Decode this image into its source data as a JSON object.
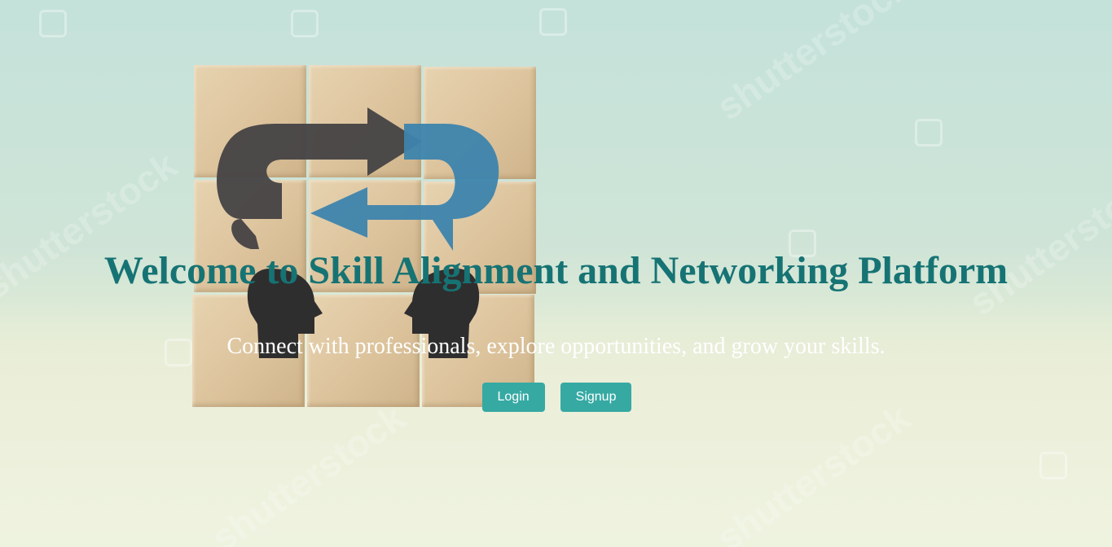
{
  "hero": {
    "title": "Welcome to Skill Alignment and Networking Platform",
    "subtitle": "Connect with professionals, explore opportunities, and grow your skills.",
    "buttons": {
      "login_label": "Login",
      "signup_label": "Signup"
    }
  },
  "background": {
    "description_icon": "wooden-cubes-exchange-arrows-heads",
    "watermark_text": "shutterstock",
    "colors": {
      "sky_top": "#c4e2da",
      "table": "#eef3e0",
      "title": "#167374",
      "button": "#36a9a3",
      "arrow_dark": "#444244",
      "arrow_blue": "#3d84ad"
    }
  }
}
